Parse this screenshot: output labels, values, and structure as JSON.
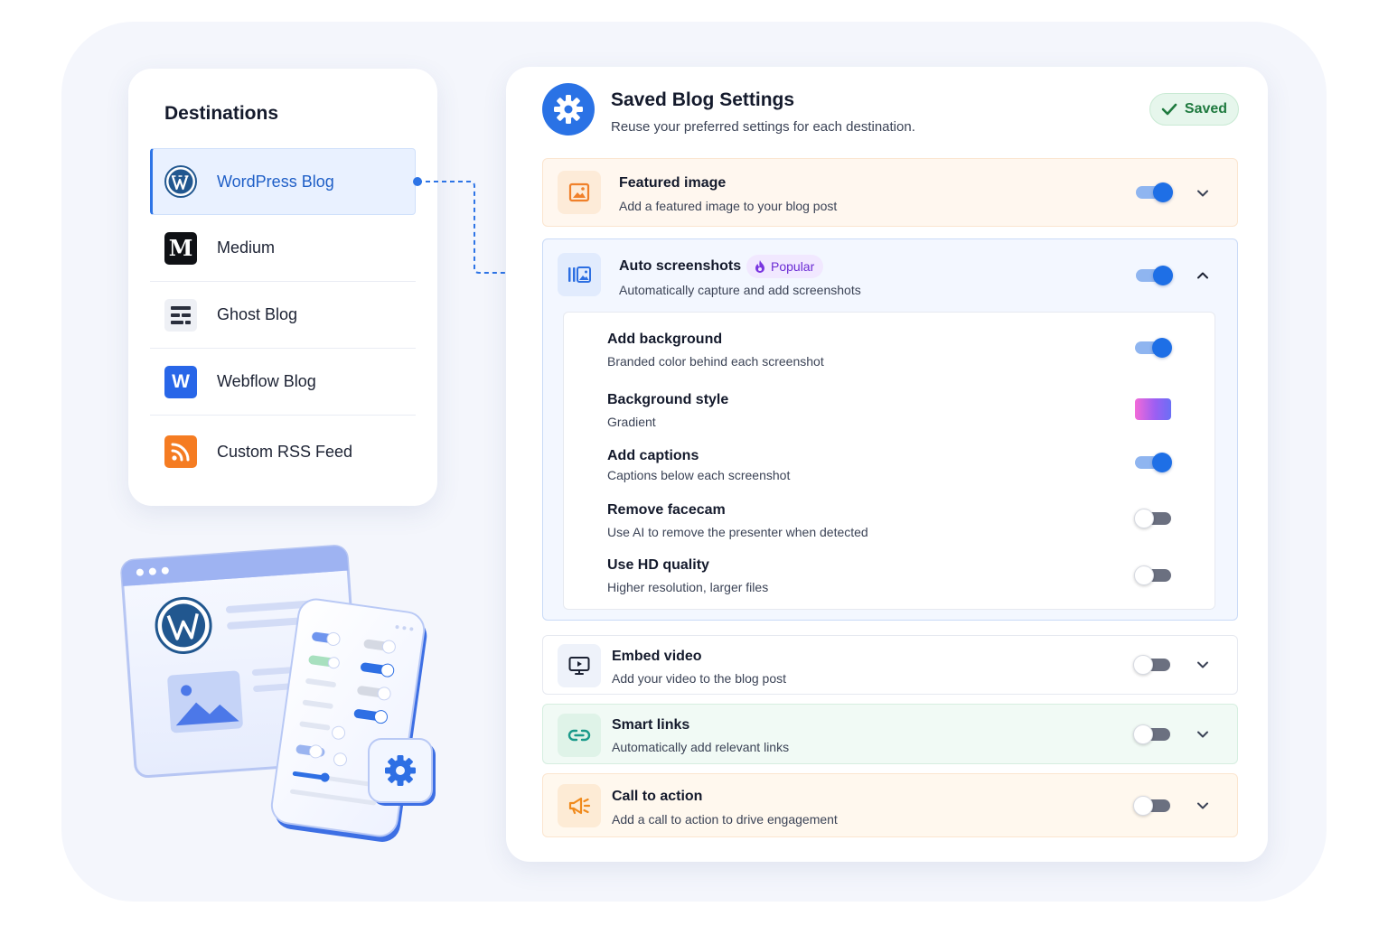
{
  "destinations": {
    "title": "Destinations",
    "items": [
      {
        "label": "WordPress Blog",
        "logo": "wordpress-icon",
        "active": true
      },
      {
        "label": "Medium",
        "logo": "medium-icon",
        "logo_text": "M"
      },
      {
        "label": "Ghost Blog",
        "logo": "ghost-icon"
      },
      {
        "label": "Webflow Blog",
        "logo": "webflow-icon",
        "logo_text": "W"
      },
      {
        "label": "Custom RSS Feed",
        "logo": "rss-icon"
      }
    ]
  },
  "panel": {
    "title": "Saved Blog Settings",
    "subtitle": "Reuse your preferred settings for each destination.",
    "saved_label": "Saved",
    "sections": {
      "featured_image": {
        "title": "Featured image",
        "desc": "Add a featured image to your blog post",
        "enabled": true,
        "expanded": false
      },
      "auto_screenshots": {
        "title": "Auto screenshots",
        "badge": "Popular",
        "desc": "Automatically capture and add screenshots",
        "enabled": true,
        "expanded": true,
        "options": [
          {
            "title": "Add background",
            "desc": "Branded color behind each screenshot",
            "enabled": true
          },
          {
            "title": "Background style",
            "desc": "Gradient"
          },
          {
            "title": "Add captions",
            "desc": "Captions below each screenshot",
            "enabled": true
          },
          {
            "title": "Remove facecam",
            "desc": "Use AI to remove the presenter when detected",
            "enabled": false
          },
          {
            "title": "Use HD quality",
            "desc": "Higher resolution, larger files",
            "enabled": false
          }
        ]
      },
      "embed_video": {
        "title": "Embed video",
        "desc": "Add your video to the blog post",
        "enabled": false,
        "expanded": false
      },
      "smart_links": {
        "title": "Smart links",
        "desc": "Automatically add relevant links",
        "enabled": false,
        "expanded": false
      },
      "call_to_action": {
        "title": "Call to action",
        "desc": "Add a call to action to drive engagement",
        "enabled": false,
        "expanded": false
      }
    }
  },
  "colors": {
    "accent": "#1e6fe6",
    "saved_green": "#1f7a3f",
    "popular_purple": "#6b2bd4",
    "featured_bg": "#fff7ef",
    "smart_links_bg": "#f1faf5",
    "cta_bg": "#fff8ee"
  }
}
